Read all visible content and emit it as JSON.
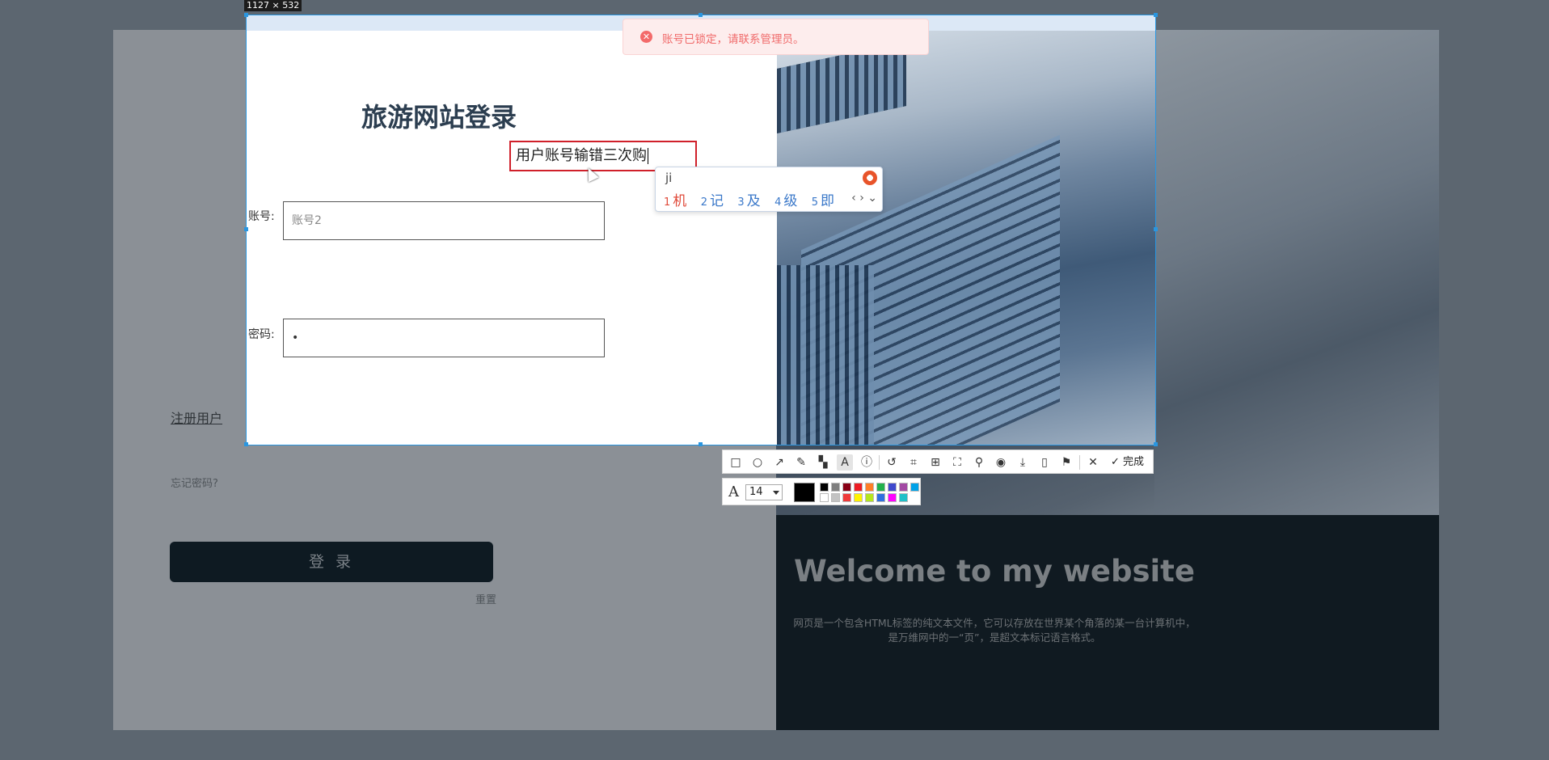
{
  "selection": {
    "size_label": "1127 × 532"
  },
  "toast": {
    "message": "账号已锁定，请联系管理员。"
  },
  "login": {
    "title": "旅游网站登录",
    "account_label": "账号:",
    "account_value": "账号2",
    "password_label": "密码:",
    "password_value": "•",
    "register_link": "注册用户",
    "forgot_link": "忘记密码?",
    "login_button": "登 录",
    "reset_button": "重置"
  },
  "annotation": {
    "text": "用户账号输错三次购"
  },
  "ime": {
    "pinyin": "ji",
    "candidates": [
      {
        "num": "1",
        "text": "机"
      },
      {
        "num": "2",
        "text": "记"
      },
      {
        "num": "3",
        "text": "及"
      },
      {
        "num": "4",
        "text": "级"
      },
      {
        "num": "5",
        "text": "即"
      }
    ],
    "nav": "‹ › ⌄"
  },
  "welcome": {
    "heading": "Welcome to my website",
    "desc_line1": "网页是一个包含HTML标签的纯文本文件，它可以存放在世界某个角落的某一台计算机中，",
    "desc_line2": "是万维网中的一“页”，是超文本标记语言格式。"
  },
  "toolbar": {
    "tools": [
      "rectangle-icon",
      "ellipse-icon",
      "arrow-icon",
      "pen-icon",
      "mosaic-icon",
      "text-icon",
      "serial-number-icon",
      "undo-icon",
      "ocr-icon",
      "translate-icon",
      "scan-icon",
      "pin-icon",
      "record-icon",
      "download-icon",
      "long-screenshot-icon",
      "bookmark-icon",
      "cancel-icon"
    ],
    "done_label": "完成",
    "font_size": "14",
    "current_color": "#000000",
    "palette": [
      "#000000",
      "#7f7f7f",
      "#880015",
      "#ed1c24",
      "#ff7f27",
      "#22b14c",
      "#3f48cc",
      "#a349a4",
      "#00a2e8",
      "#ffffff",
      "#c3c3c3",
      "#ef3a3a",
      "#fff200",
      "#b5e61d",
      "#2f6fe0",
      "#ff00ff",
      "#20c0c8"
    ]
  }
}
